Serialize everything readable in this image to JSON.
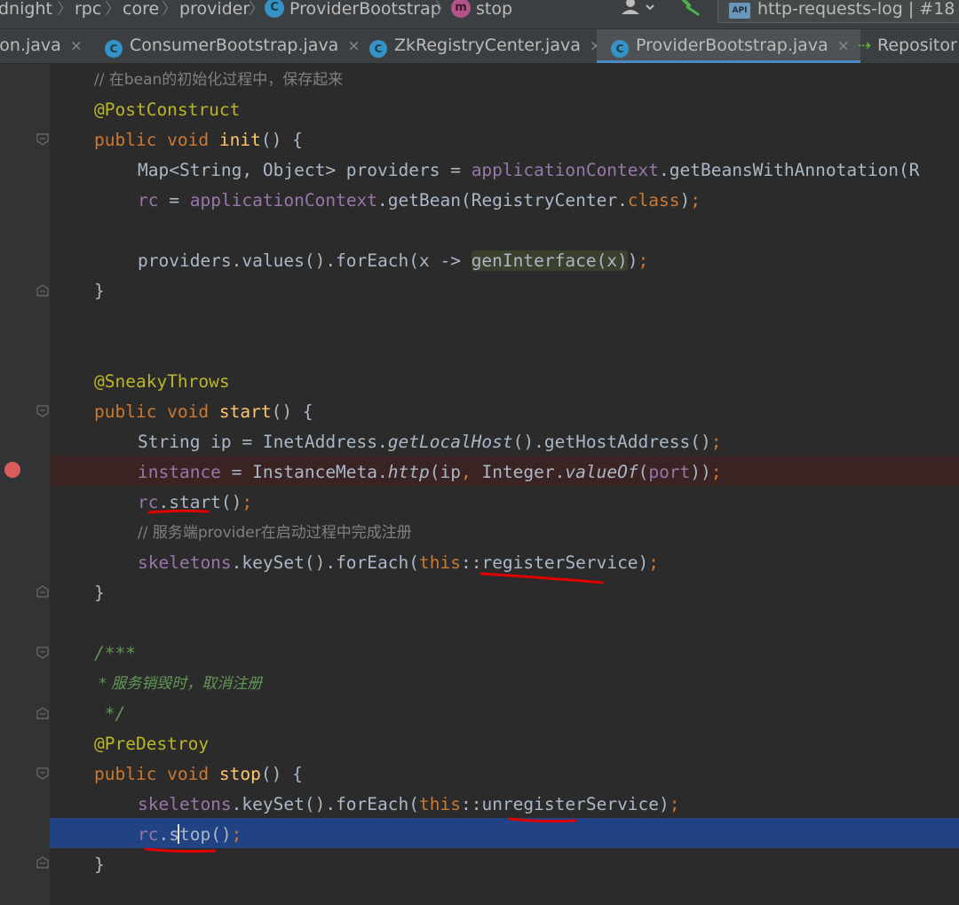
{
  "breadcrumb": {
    "items": [
      "dnight",
      "rpc",
      "core",
      "provider",
      "ProviderBootstrap",
      "stop"
    ],
    "separator": "〉",
    "class_badge": "C",
    "method_badge": "m"
  },
  "toolbar": {
    "run_config": "http-requests-log | #18",
    "run_config_icon_text": "API"
  },
  "tabs": [
    {
      "label": "ion.java",
      "close": "×"
    },
    {
      "label": "ConsumerBootstrap.java",
      "close": "×"
    },
    {
      "label": "ZkRegistryCenter.java",
      "close": "×"
    },
    {
      "label": "ProviderBootstrap.java",
      "close": "×"
    },
    {
      "label": "Repositor"
    }
  ],
  "code": {
    "l1": "// 在bean的初始化过程中，保存起来",
    "l2": "@PostConstruct",
    "l3": {
      "kw": "public void ",
      "name": "init",
      "rest": "() {"
    },
    "l4": {
      "a": "Map<String, Object> providers = ",
      "f": "applicationContext",
      "b": ".getBeansWithAnnotation(R"
    },
    "l5": {
      "f1": "rc",
      "a": " = ",
      "f2": "applicationContext",
      "b": ".getBean(RegistryCenter.",
      "kw": "class",
      "c": ")",
      "semi": ";"
    },
    "l6": {
      "a": "providers.values().forEach(x -> ",
      "h": "genInterface(x)",
      "b": ")",
      "semi": ";"
    },
    "l7": "}",
    "l8": "@SneakyThrows",
    "l9": {
      "kw": "public void ",
      "name": "start",
      "rest": "() {"
    },
    "l10": {
      "a": "String ip = InetAddress.",
      "s": "getLocalHost",
      "b": "().getHostAddress()",
      "semi": ";"
    },
    "l11": {
      "f": "instance",
      "a": " = InstanceMeta.",
      "s": "http",
      "b": "(ip",
      "comma": ",",
      "c": " Integer.",
      "s2": "valueOf",
      "d": "(",
      "f2": "port",
      "e": "))",
      "semi": ";"
    },
    "l12": {
      "f": "rc",
      "a": ".start()",
      "semi": ";"
    },
    "l13": "// 服务端provider在启动过程中完成注册",
    "l14": {
      "f": "skeletons",
      "a": ".keySet().forEach(",
      "kw": "this",
      "b": "::registerService)",
      "semi": ";"
    },
    "l15": "}",
    "l16": "/***",
    "l17": " * 服务销毁时，取消注册",
    "l18": " */",
    "l19": "@PreDestroy",
    "l20": {
      "kw": "public void ",
      "name": "stop",
      "rest": "() {"
    },
    "l21": {
      "f": "skeletons",
      "a": ".keySet().forEach(",
      "kw": "this",
      "b": "::unregisterService)",
      "semi": ";"
    },
    "l22": {
      "f": "rc",
      "a": ".s",
      "b": "top()",
      "semi": ";"
    },
    "l23": "}"
  },
  "colors": {
    "background": "#2b2b2b",
    "keyword": "#cc7832",
    "annotation": "#bbb529",
    "field": "#9876aa",
    "comment": "#808080",
    "doc_comment": "#629755",
    "method_decl": "#ffc66d",
    "selection": "#214283",
    "breakpoint": "#db5c5c",
    "ink_annotation": "#e00000"
  }
}
